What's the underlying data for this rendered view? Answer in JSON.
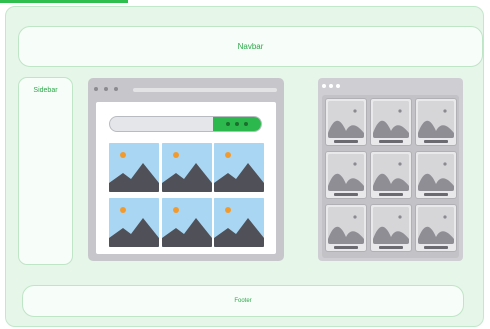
{
  "labels": {
    "navbar": "Navbar",
    "sidebar": "Sidebar",
    "footer": "Footer"
  },
  "icons": {
    "photo": "landscape-photo-icon",
    "card_image": "landscape-thumbnail-icon"
  },
  "colors": {
    "accent": "#2cb84c",
    "background": "#e6f6e9",
    "sky": "#a9d7f3",
    "sun": "#f39a2c",
    "mountain": "#505058"
  }
}
